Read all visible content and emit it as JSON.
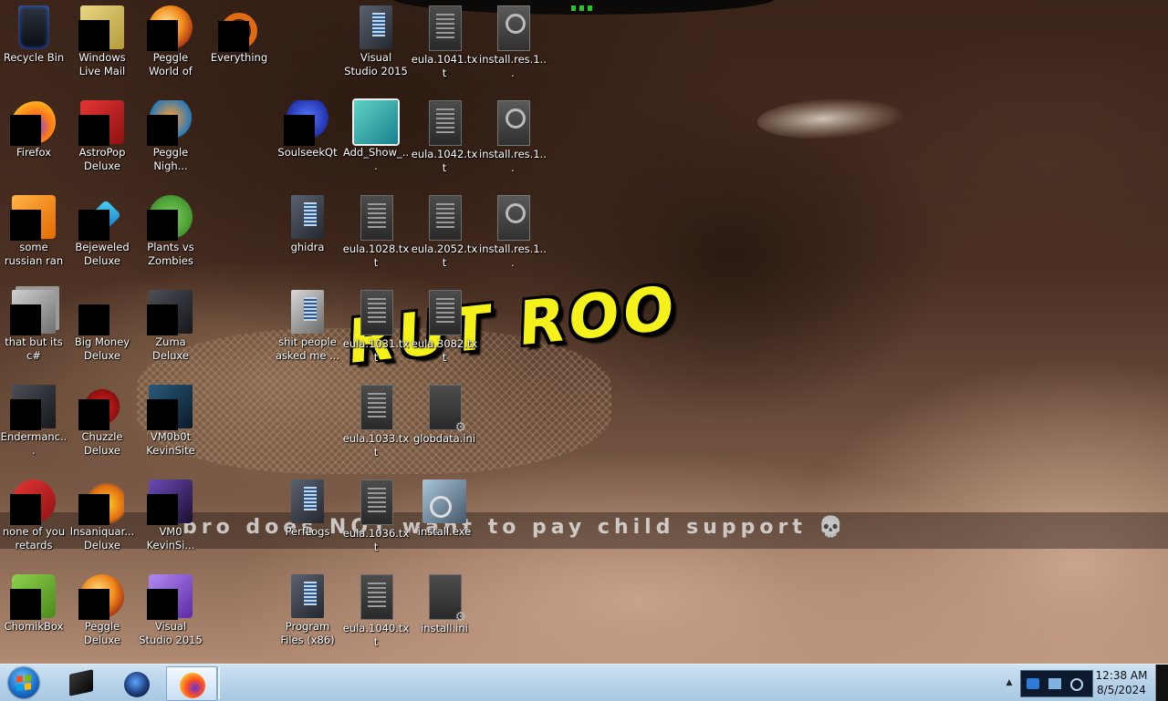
{
  "wallpaper": {
    "meme_text": "RUT ROO",
    "caption": "bro does NOT want to pay child support 💀"
  },
  "desktop_icons": [
    {
      "label": "Recycle Bin",
      "icon": "recycle-bin-icon"
    },
    {
      "label": "Windows Live Mail",
      "icon": "mail-icon"
    },
    {
      "label": "Peggle World of Warcraft ...",
      "icon": "peggle-icon"
    },
    {
      "label": "Everything",
      "icon": "search-ring-icon"
    },
    {
      "label": "Firefox",
      "icon": "firefox-icon"
    },
    {
      "label": "AstroPop Deluxe",
      "icon": "astropop-icon"
    },
    {
      "label": "Peggle Nigh...",
      "icon": "peggle-icon"
    },
    {
      "label": "some russian ran a rat",
      "icon": "app-icon"
    },
    {
      "label": "Bejeweled Deluxe",
      "icon": "gem-icon"
    },
    {
      "label": "Plants vs Zombies",
      "icon": "plant-icon"
    },
    {
      "label": "that but its c#",
      "icon": "folder-stack-icon"
    },
    {
      "label": "Big Money Deluxe",
      "icon": "money-icon"
    },
    {
      "label": "Zuma Deluxe",
      "icon": "window-icon"
    },
    {
      "label": "Endermanc...",
      "icon": "window-icon"
    },
    {
      "label": "Chuzzle Deluxe",
      "icon": "chuzzle-icon"
    },
    {
      "label": "VM0b0t KevinSite",
      "icon": "vm-icon"
    },
    {
      "label": "none of you retards kno...",
      "icon": "app-icon"
    },
    {
      "label": "Insaniquar... Deluxe",
      "icon": "fish-icon"
    },
    {
      "label": "VM0 KevinSi...",
      "icon": "vm-icon"
    },
    {
      "label": "ChomikBox",
      "icon": "chomikbox-icon"
    },
    {
      "label": "Peggle Deluxe",
      "icon": "peggle-icon"
    },
    {
      "label": "Visual Studio 2015",
      "icon": "visual-studio-icon"
    },
    {
      "label": "Visual Studio 2015",
      "icon": "folder-icon"
    },
    {
      "label": "eula.1041.txt",
      "icon": "text-file-icon"
    },
    {
      "label": "install.res.1...",
      "icon": "resource-file-icon"
    },
    {
      "label": "SoulseekQt",
      "icon": "soulseek-icon"
    },
    {
      "label": "Add_Show_...",
      "icon": "registry-file-icon"
    },
    {
      "label": "eula.1042.txt",
      "icon": "text-file-icon"
    },
    {
      "label": "install.res.1...",
      "icon": "resource-file-icon"
    },
    {
      "label": "ghidra",
      "icon": "folder-icon"
    },
    {
      "label": "eula.1028.txt",
      "icon": "text-file-icon"
    },
    {
      "label": "eula.2052.txt",
      "icon": "text-file-icon"
    },
    {
      "label": "install.res.1...",
      "icon": "resource-file-icon"
    },
    {
      "label": "shit people asked me ...",
      "icon": "folder-icon"
    },
    {
      "label": "eula.1031.txt",
      "icon": "text-file-icon"
    },
    {
      "label": "eula.3082.txt",
      "icon": "text-file-icon"
    },
    {
      "label": "eula.1033.txt",
      "icon": "text-file-icon"
    },
    {
      "label": "globdata.ini",
      "icon": "ini-file-icon"
    },
    {
      "label": "PerfLogs",
      "icon": "folder-icon"
    },
    {
      "label": "eula.1036.txt",
      "icon": "text-file-icon"
    },
    {
      "label": "install.exe",
      "icon": "installer-icon"
    },
    {
      "label": "Program Files (x86)",
      "icon": "folder-icon"
    },
    {
      "label": "eula.1040.txt",
      "icon": "text-file-icon"
    },
    {
      "label": "install.ini",
      "icon": "ini-file-icon"
    }
  ],
  "taskbar": {
    "start_icon": "windows-start-icon",
    "pinned": [
      {
        "name": "command-prompt",
        "icon": "terminal-icon"
      },
      {
        "name": "ghidra",
        "icon": "ghidra-icon"
      },
      {
        "name": "firefox",
        "icon": "firefox-icon",
        "active": true
      }
    ],
    "tray": {
      "expand_icon": "chevron-up-icon",
      "icons": [
        "shield-icon",
        "network-icon",
        "volume-icon"
      ]
    },
    "clock": {
      "time": "12:38 AM",
      "date": "8/5/2024"
    }
  },
  "colors": {
    "taskbar_top": "#cfe3f2",
    "taskbar_bottom": "#a8c8e2",
    "meme_text": "#f4f11b"
  }
}
